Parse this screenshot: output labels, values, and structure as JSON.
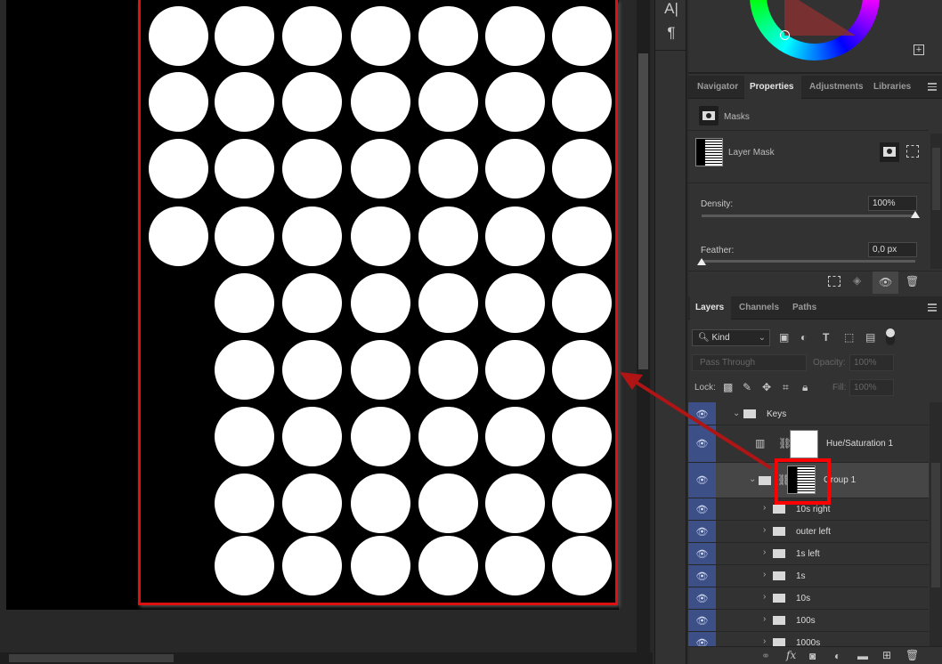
{
  "canvas": {
    "grid": {
      "rows": 9,
      "cols": 7,
      "short_rows_start": 4,
      "short_row_skip": 1
    },
    "colors": {
      "selection": "#e01010",
      "arrow": "#b01515"
    }
  },
  "toolstrip": {
    "type_tool": "A|",
    "paragraph_tool": "¶"
  },
  "color_panel": {
    "add_icon": "+"
  },
  "properties": {
    "tabs": [
      "Navigator",
      "Properties",
      "Adjustments",
      "Libraries"
    ],
    "active_tab": "Properties",
    "section": "Masks",
    "mask_label": "Layer Mask",
    "density_label": "Density:",
    "density_value": "100%",
    "density_fraction": 1.0,
    "feather_label": "Feather:",
    "feather_value": "0,0 px",
    "feather_fraction": 0.0
  },
  "layers": {
    "tabs": [
      "Layers",
      "Channels",
      "Paths"
    ],
    "active_tab": "Layers",
    "filter": "Kind",
    "blend_mode": "Pass Through",
    "opacity_label": "Opacity:",
    "opacity_value": "100%",
    "lock_label": "Lock:",
    "fill_label": "Fill:",
    "fill_value": "100%",
    "items": [
      {
        "name": "Keys",
        "type": "group",
        "expanded": true,
        "indent": 0
      },
      {
        "name": "Hue/Saturation 1",
        "type": "adjustment",
        "indent": 1
      },
      {
        "name": "Group 1",
        "type": "group",
        "expanded": true,
        "indent": 1,
        "selected": true
      },
      {
        "name": "10s right",
        "type": "group",
        "indent": 2
      },
      {
        "name": "outer left",
        "type": "group",
        "indent": 2
      },
      {
        "name": "1s left",
        "type": "group",
        "indent": 2
      },
      {
        "name": "1s",
        "type": "group",
        "indent": 2
      },
      {
        "name": "10s",
        "type": "group",
        "indent": 2
      },
      {
        "name": "100s",
        "type": "group",
        "indent": 2
      },
      {
        "name": "1000s",
        "type": "group",
        "indent": 2
      }
    ],
    "footer": {
      "fx": "fx"
    }
  }
}
